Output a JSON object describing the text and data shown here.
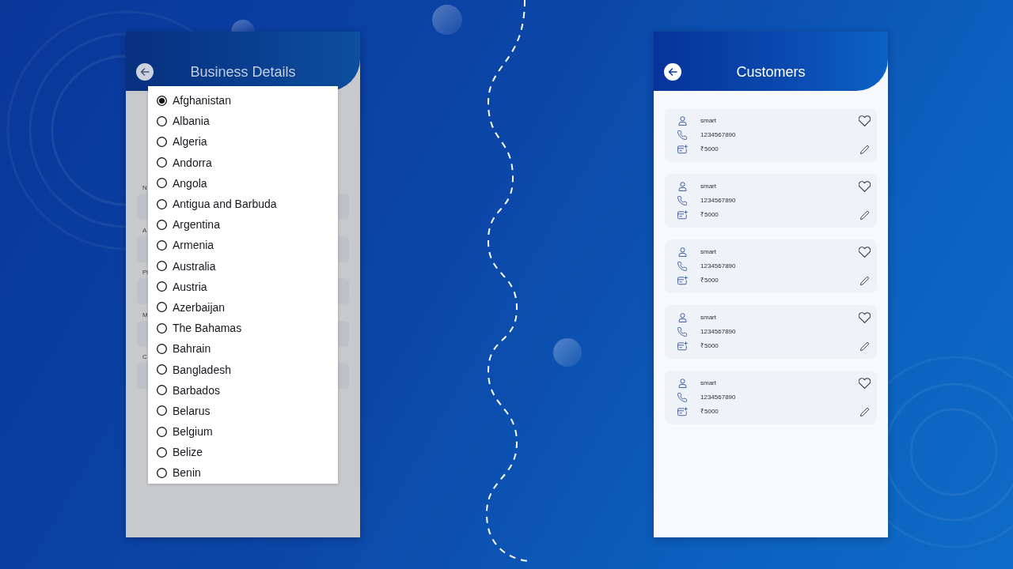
{
  "business_details_screen": {
    "title": "Business Details",
    "form_fields": [
      {
        "label": "N"
      },
      {
        "label": "A"
      },
      {
        "label": "Pl"
      },
      {
        "label": "M"
      },
      {
        "label": "C"
      }
    ],
    "country_options": [
      {
        "label": "Afghanistan",
        "selected": true
      },
      {
        "label": "Albania",
        "selected": false
      },
      {
        "label": "Algeria",
        "selected": false
      },
      {
        "label": "Andorra",
        "selected": false
      },
      {
        "label": "Angola",
        "selected": false
      },
      {
        "label": "Antigua and Barbuda",
        "selected": false
      },
      {
        "label": "Argentina",
        "selected": false
      },
      {
        "label": "Armenia",
        "selected": false
      },
      {
        "label": "Australia",
        "selected": false
      },
      {
        "label": "Austria",
        "selected": false
      },
      {
        "label": "Azerbaijan",
        "selected": false
      },
      {
        "label": "The Bahamas",
        "selected": false
      },
      {
        "label": "Bahrain",
        "selected": false
      },
      {
        "label": "Bangladesh",
        "selected": false
      },
      {
        "label": "Barbados",
        "selected": false
      },
      {
        "label": "Belarus",
        "selected": false
      },
      {
        "label": "Belgium",
        "selected": false
      },
      {
        "label": "Belize",
        "selected": false
      },
      {
        "label": "Benin",
        "selected": false
      }
    ]
  },
  "customers_screen": {
    "title": "Customers",
    "customers": [
      {
        "name": "smart",
        "phone": "1234567890",
        "amount": "₹5000",
        "favorite": false
      },
      {
        "name": "smart",
        "phone": "1234567890",
        "amount": "₹5000",
        "favorite": false
      },
      {
        "name": "smart",
        "phone": "1234567890",
        "amount": "₹5000",
        "favorite": false
      },
      {
        "name": "smart",
        "phone": "1234567890",
        "amount": "₹5000",
        "favorite": false
      },
      {
        "name": "smart",
        "phone": "1234567890",
        "amount": "₹5000",
        "favorite": false
      }
    ]
  }
}
